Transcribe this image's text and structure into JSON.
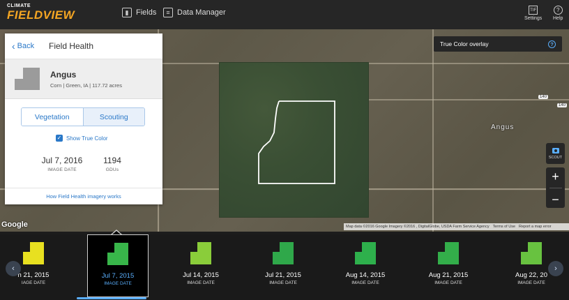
{
  "header": {
    "logo_small": "CLIMATE",
    "logo_big": "FIELDVIEW",
    "nav": [
      {
        "label": "Fields",
        "icon": "fields-icon"
      },
      {
        "label": "Data Manager",
        "icon": "data-manager-icon"
      }
    ],
    "tools": [
      {
        "label": "Settings",
        "icon": "settings-icon",
        "glyph": "TIF"
      },
      {
        "label": "Help",
        "icon": "help-icon",
        "glyph": "?"
      }
    ]
  },
  "map": {
    "overlay_label": "True Color overlay",
    "overlay_help": "?",
    "town_label": "Angus",
    "shield_1": "140",
    "shield_2": "140",
    "scout_label": "SCOUT",
    "zoom_in": "+",
    "zoom_out": "−",
    "google_label": "Google",
    "attribution": "Map data ©2016 Google Imagery ©2016 , DigitalGlobe, USDA Farm Service Agency",
    "terms": "Terms of Use",
    "report": "Report a map error"
  },
  "panel": {
    "back_label": "Back",
    "title": "Field Health",
    "field": {
      "name": "Angus",
      "details": "Corn  |  Green, IA  |  117.72 acres"
    },
    "tabs": [
      {
        "label": "Vegetation",
        "active": false
      },
      {
        "label": "Scouting",
        "active": true
      }
    ],
    "show_true_color_label": "Show True Color",
    "image_date_value": "Jul 7, 2016",
    "image_date_label": "IMAGE DATE",
    "gdu_value": "1194",
    "gdu_label": "GDUs",
    "help_link": "How Field Health imagery works"
  },
  "timeline": {
    "items": [
      {
        "date": "n 21, 2015",
        "label": "IAGE DATE",
        "color": "#e8e020",
        "active": false
      },
      {
        "date": "Jul 7, 2015",
        "label": "IMAGE DATE",
        "color": "#38b64a",
        "active": true
      },
      {
        "date": "Jul 14, 2015",
        "label": "IMAGE DATE",
        "color": "#8acd3a",
        "active": false
      },
      {
        "date": "Jul 21, 2015",
        "label": "IMAGE DATE",
        "color": "#2fa84a",
        "active": false
      },
      {
        "date": "Aug 14, 2015",
        "label": "IMAGE DATE",
        "color": "#2eb04c",
        "active": false
      },
      {
        "date": "Aug 21, 2015",
        "label": "IMAGE DATE",
        "color": "#33ae4a",
        "active": false
      },
      {
        "date": "Aug 22, 20",
        "label": "IMAGE DATE",
        "color": "#68c240",
        "active": false
      }
    ],
    "prev": "‹",
    "next": "›"
  }
}
